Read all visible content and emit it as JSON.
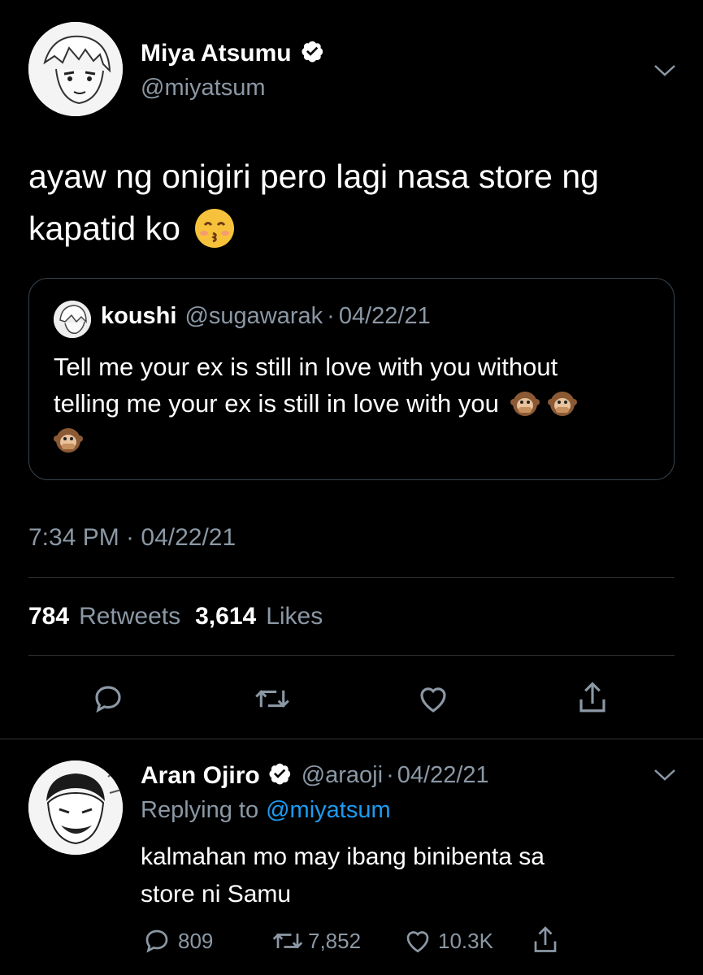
{
  "main_tweet": {
    "author_name": "Miya Atsumu",
    "author_handle": "@miyatsum",
    "text_line1": "ayaw ng onigiri pero lagi nasa store ng",
    "text_line2": "kapatid ko",
    "emoji": "kissing-face-with-smiling-eyes",
    "timestamp": "7:34 PM · 04/22/21",
    "retweets_count": "784",
    "retweets_label": "Retweets",
    "likes_count": "3,614",
    "likes_label": "Likes"
  },
  "quoted_tweet": {
    "author_name": "koushi",
    "author_handle": "@sugawarak",
    "separator": "·",
    "date": "04/22/21",
    "text_line1": "Tell me your ex is still in love with you without",
    "text_line2": "telling me your ex is still in love with you",
    "emoji": "speak-no-evil-monkey"
  },
  "reply_tweet": {
    "author_name": "Aran Ojiro",
    "author_handle": "@araoji",
    "separator": "·",
    "date": "04/22/21",
    "replying_prefix": "Replying to",
    "replying_to": "@miyatsum",
    "text_line1": "kalmahan mo may ibang binibenta sa",
    "text_line2": "store ni Samu",
    "reply_count": "809",
    "retweet_count": "7,852",
    "like_count": "10.3K"
  },
  "colors": {
    "background": "#000000",
    "muted": "#8b98a5",
    "accent": "#1d9bf0",
    "divider": "#2f3336"
  },
  "icons": [
    "verified-icon",
    "chevron-down-icon",
    "reply-icon",
    "retweet-icon",
    "like-icon",
    "share-icon"
  ]
}
